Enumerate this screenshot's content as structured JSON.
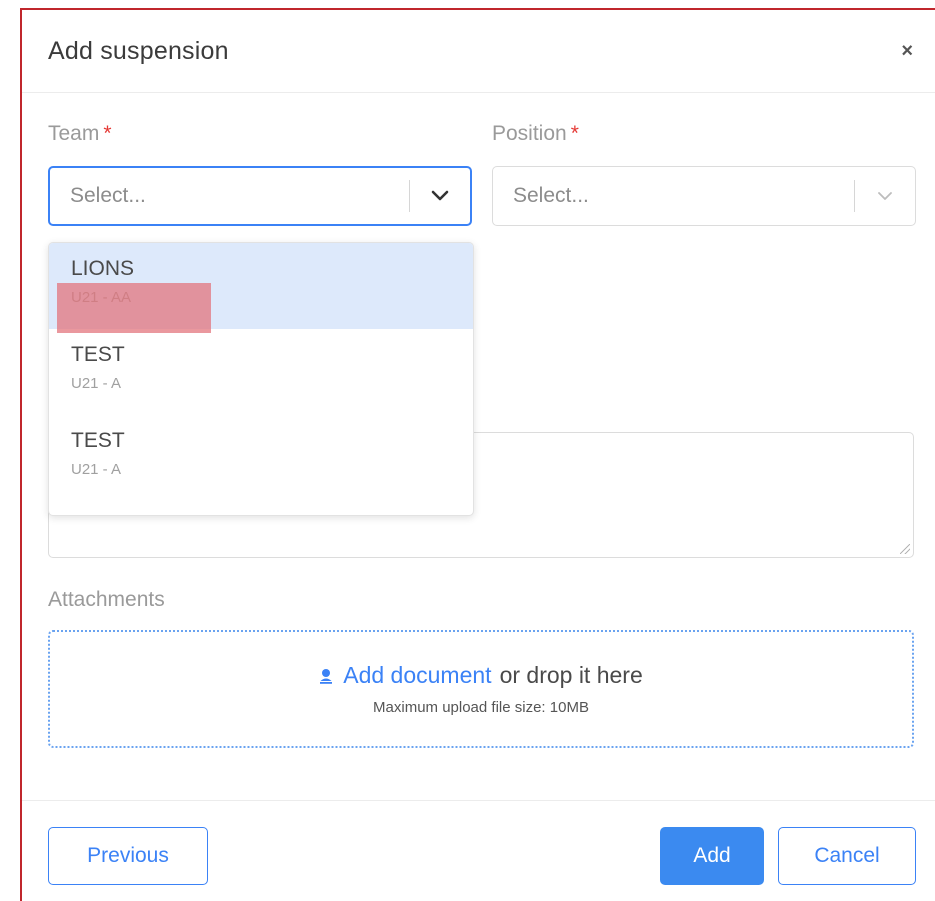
{
  "modal": {
    "title": "Add suspension",
    "close_label": "×"
  },
  "team": {
    "label": "Team",
    "required_mark": "*",
    "placeholder": "Select...",
    "options": [
      {
        "name": "LIONS",
        "sub": "U21 - AA",
        "highlighted": true
      },
      {
        "name": "TEST",
        "sub": "U21 - A",
        "highlighted": false
      },
      {
        "name": "TEST",
        "sub": "U21 - A",
        "highlighted": false
      }
    ]
  },
  "position": {
    "label": "Position",
    "required_mark": "*",
    "placeholder": "Select..."
  },
  "attachments": {
    "label": "Attachments",
    "upload_link": "Add document",
    "upload_rest": "or drop it here",
    "note": "Maximum upload file size: 10MB"
  },
  "footer": {
    "previous_label": "Previous",
    "add_label": "Add",
    "cancel_label": "Cancel"
  },
  "colors": {
    "accent": "#3b82f6",
    "required": "#e53935",
    "highlight": "#dde9fb",
    "redaction": "#e27078"
  },
  "icons": [
    "chevron-down-icon",
    "close-icon",
    "upload-icon",
    "resize-handle-icon"
  ]
}
